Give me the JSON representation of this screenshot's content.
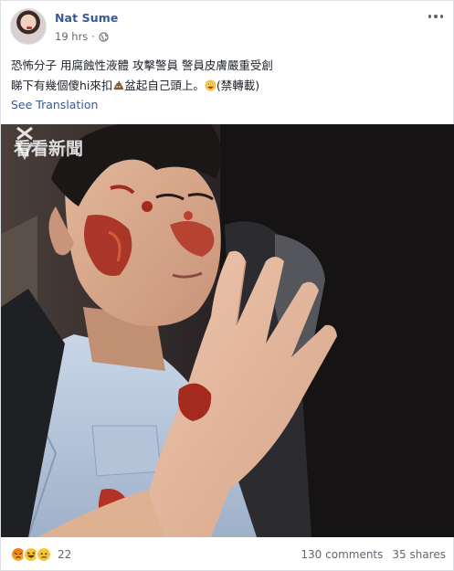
{
  "post": {
    "author": "Nat Sume",
    "time": "19 hrs",
    "separator": "·",
    "privacy_icon": "globe-icon",
    "more_icon": "more-options-icon",
    "text_line1": "恐怖分子 用腐蝕性液體 攻擊警員 警員皮膚嚴重受創",
    "text_line2_a": "睇下有幾個傻hi來扣",
    "text_line2_b": "盆起自己頭上。",
    "text_line2_c": "(禁轉載)",
    "inline_emoji_1": "poop-emoji",
    "inline_emoji_2": "crazy-face-emoji",
    "see_translation": "See Translation"
  },
  "photo": {
    "watermark_text": "看看新聞",
    "description_icon": "watermark-logo-icon"
  },
  "footer": {
    "reactions": [
      "angry-reaction-icon",
      "haha-reaction-icon",
      "sad-reaction-icon"
    ],
    "reaction_count": "22",
    "comments": "130 comments",
    "shares": "35 shares"
  },
  "colors": {
    "link": "#385898",
    "meta": "#606770",
    "text": "#1d2129"
  }
}
